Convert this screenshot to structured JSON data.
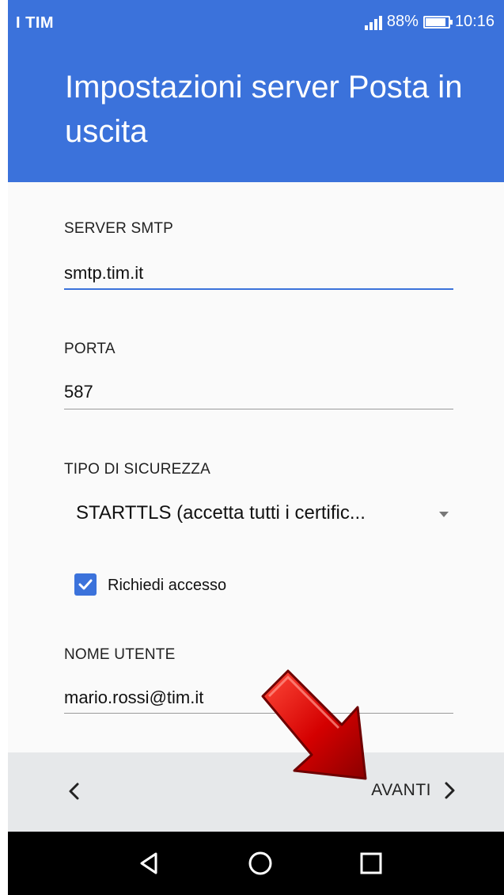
{
  "status_bar": {
    "carrier": "I TIM",
    "battery_percent_text": "88%",
    "battery_level": 0.88,
    "time": "10:16",
    "network_icon": "signal-bars-icon"
  },
  "header": {
    "title": "Impostazioni server Posta in uscita"
  },
  "form": {
    "smtp_label": "SERVER SMTP",
    "smtp_value": "smtp.tim.it",
    "port_label": "PORTA",
    "port_value": "587",
    "security_label": "TIPO DI SICUREZZA",
    "security_value": "STARTTLS (accetta tutti i certific...",
    "require_login_label": "Richiedi accesso",
    "require_login_checked": true,
    "username_label": "NOME UTENTE",
    "username_value": "mario.rossi@tim.it"
  },
  "bottom_bar": {
    "back_icon": "chevron-left-icon",
    "next_label": "AVANTI",
    "next_icon": "chevron-right-icon"
  },
  "nav_bar": {
    "back": "triangle-back-icon",
    "home": "circle-home-icon",
    "recents": "square-recents-icon"
  },
  "colors": {
    "accent": "#3b72db",
    "arrow_red": "#d40000"
  }
}
